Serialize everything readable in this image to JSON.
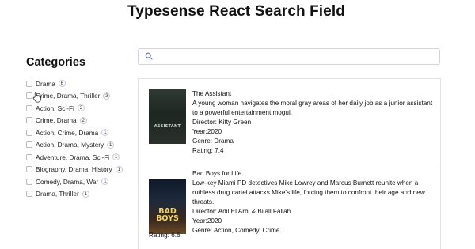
{
  "header": {
    "title": "Typesense React Search Field"
  },
  "sidebar": {
    "heading": "Categories",
    "items": [
      {
        "label": "Drama",
        "count": "6"
      },
      {
        "label": "Crime, Drama, Thriller",
        "count": "3"
      },
      {
        "label": "Action, Sci-Fi",
        "count": "2"
      },
      {
        "label": "Crime, Drama",
        "count": "2"
      },
      {
        "label": "Action, Crime, Drama",
        "count": "1"
      },
      {
        "label": "Action, Drama, Mystery",
        "count": "1"
      },
      {
        "label": "Adventure, Drama, Sci-Fi",
        "count": "1"
      },
      {
        "label": "Biography, Drama, History",
        "count": "1"
      },
      {
        "label": "Comedy, Drama, War",
        "count": "1"
      },
      {
        "label": "Drama, Thriller",
        "count": "1"
      }
    ]
  },
  "search": {
    "value": "",
    "placeholder": "",
    "icon": "search-icon"
  },
  "results": [
    {
      "title": "The Assistant",
      "description": "A young woman navigates the moral gray areas of her daily job as a junior assistant to a powerful entertainment mogul.",
      "director": "Director: Kitty Green",
      "year": "Year:2020",
      "genre": "Genre: Drama",
      "rating": "Rating: 7.4",
      "poster_text": "ASSISTANT"
    },
    {
      "title": "Bad Boys for Life",
      "description": "Low-key Miami PD detectives Mike Lowrey and Marcus Burnett reunite when a ruthless drug cartel attacks Mike's life, forcing them to confront their age and new threats.",
      "director": "Director: Adil El Arbi & Bilall Fallah",
      "year": "Year:2020",
      "genre": "Genre: Action, Comedy, Crime",
      "rating": "Rating: 6.6",
      "poster_text": "BAD BOYS"
    }
  ],
  "colors": {
    "search_border": "#c9d3f2",
    "divider": "#e3e3e3",
    "accent": "#5b6fd6"
  }
}
